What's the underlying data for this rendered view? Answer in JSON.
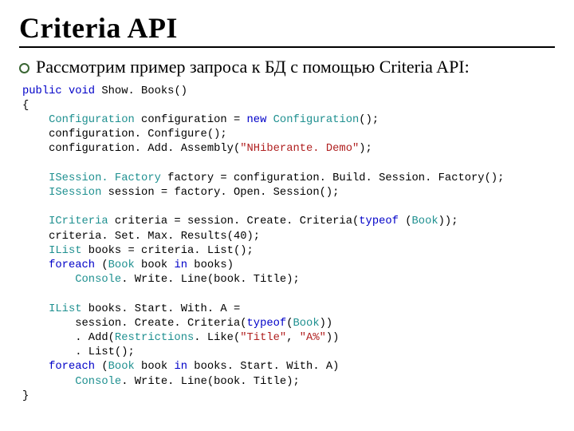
{
  "title": "Criteria API",
  "bullet": "Рассмотрим пример запроса к БД с помощью Criteria API:",
  "code": {
    "t": {
      "public": "public",
      "void": "void",
      "new": "new",
      "typeof": "typeof",
      "foreach": "foreach",
      "in": "in"
    },
    "ty": {
      "Configuration": "Configuration",
      "ISessionFactory": "ISession. Factory",
      "ISession": "ISession",
      "ICriteria": "ICriteria",
      "IList": "IList",
      "Book": "Book",
      "Console": "Console",
      "Restrictions": "Restrictions"
    },
    "s": {
      "demo": "\"NHiberante. Demo\"",
      "title": "\"Title\"",
      "pattern": "\"A%\""
    },
    "fn": {
      "method": " Show. Books()",
      "obrace": "{",
      "varcfg": " configuration = ",
      "newcfg": "();",
      "cfgConfigure": "    configuration. Configure();",
      "cfgAdd1": "    configuration. Add. Assembly(",
      "cfgAdd2": ");",
      "factory": " factory = configuration. Build. Session. Factory();",
      "session": " session = factory. Open. Session();",
      "crit1": " criteria = session. Create. Criteria(",
      "crit2": " (",
      "crit3": "));",
      "setmax": "    criteria. Set. Max. Results(40);",
      "books": " books = criteria. List();",
      "fe1": " (",
      "fe2": " book ",
      "fe3": " books)",
      "wl1": ". Write. Line(book. Title);",
      "booksA1": " books. Start. With. A =",
      "booksA2": "        session. Create. Criteria(",
      "booksA3": "(",
      "booksA4": "))",
      "add1": "        . Add(",
      "add2": ". Like(",
      "add3": ", ",
      "add4": "))",
      "list": "        . List();",
      "feB3": " books. Start. With. A)",
      "cbrace": "}"
    }
  }
}
